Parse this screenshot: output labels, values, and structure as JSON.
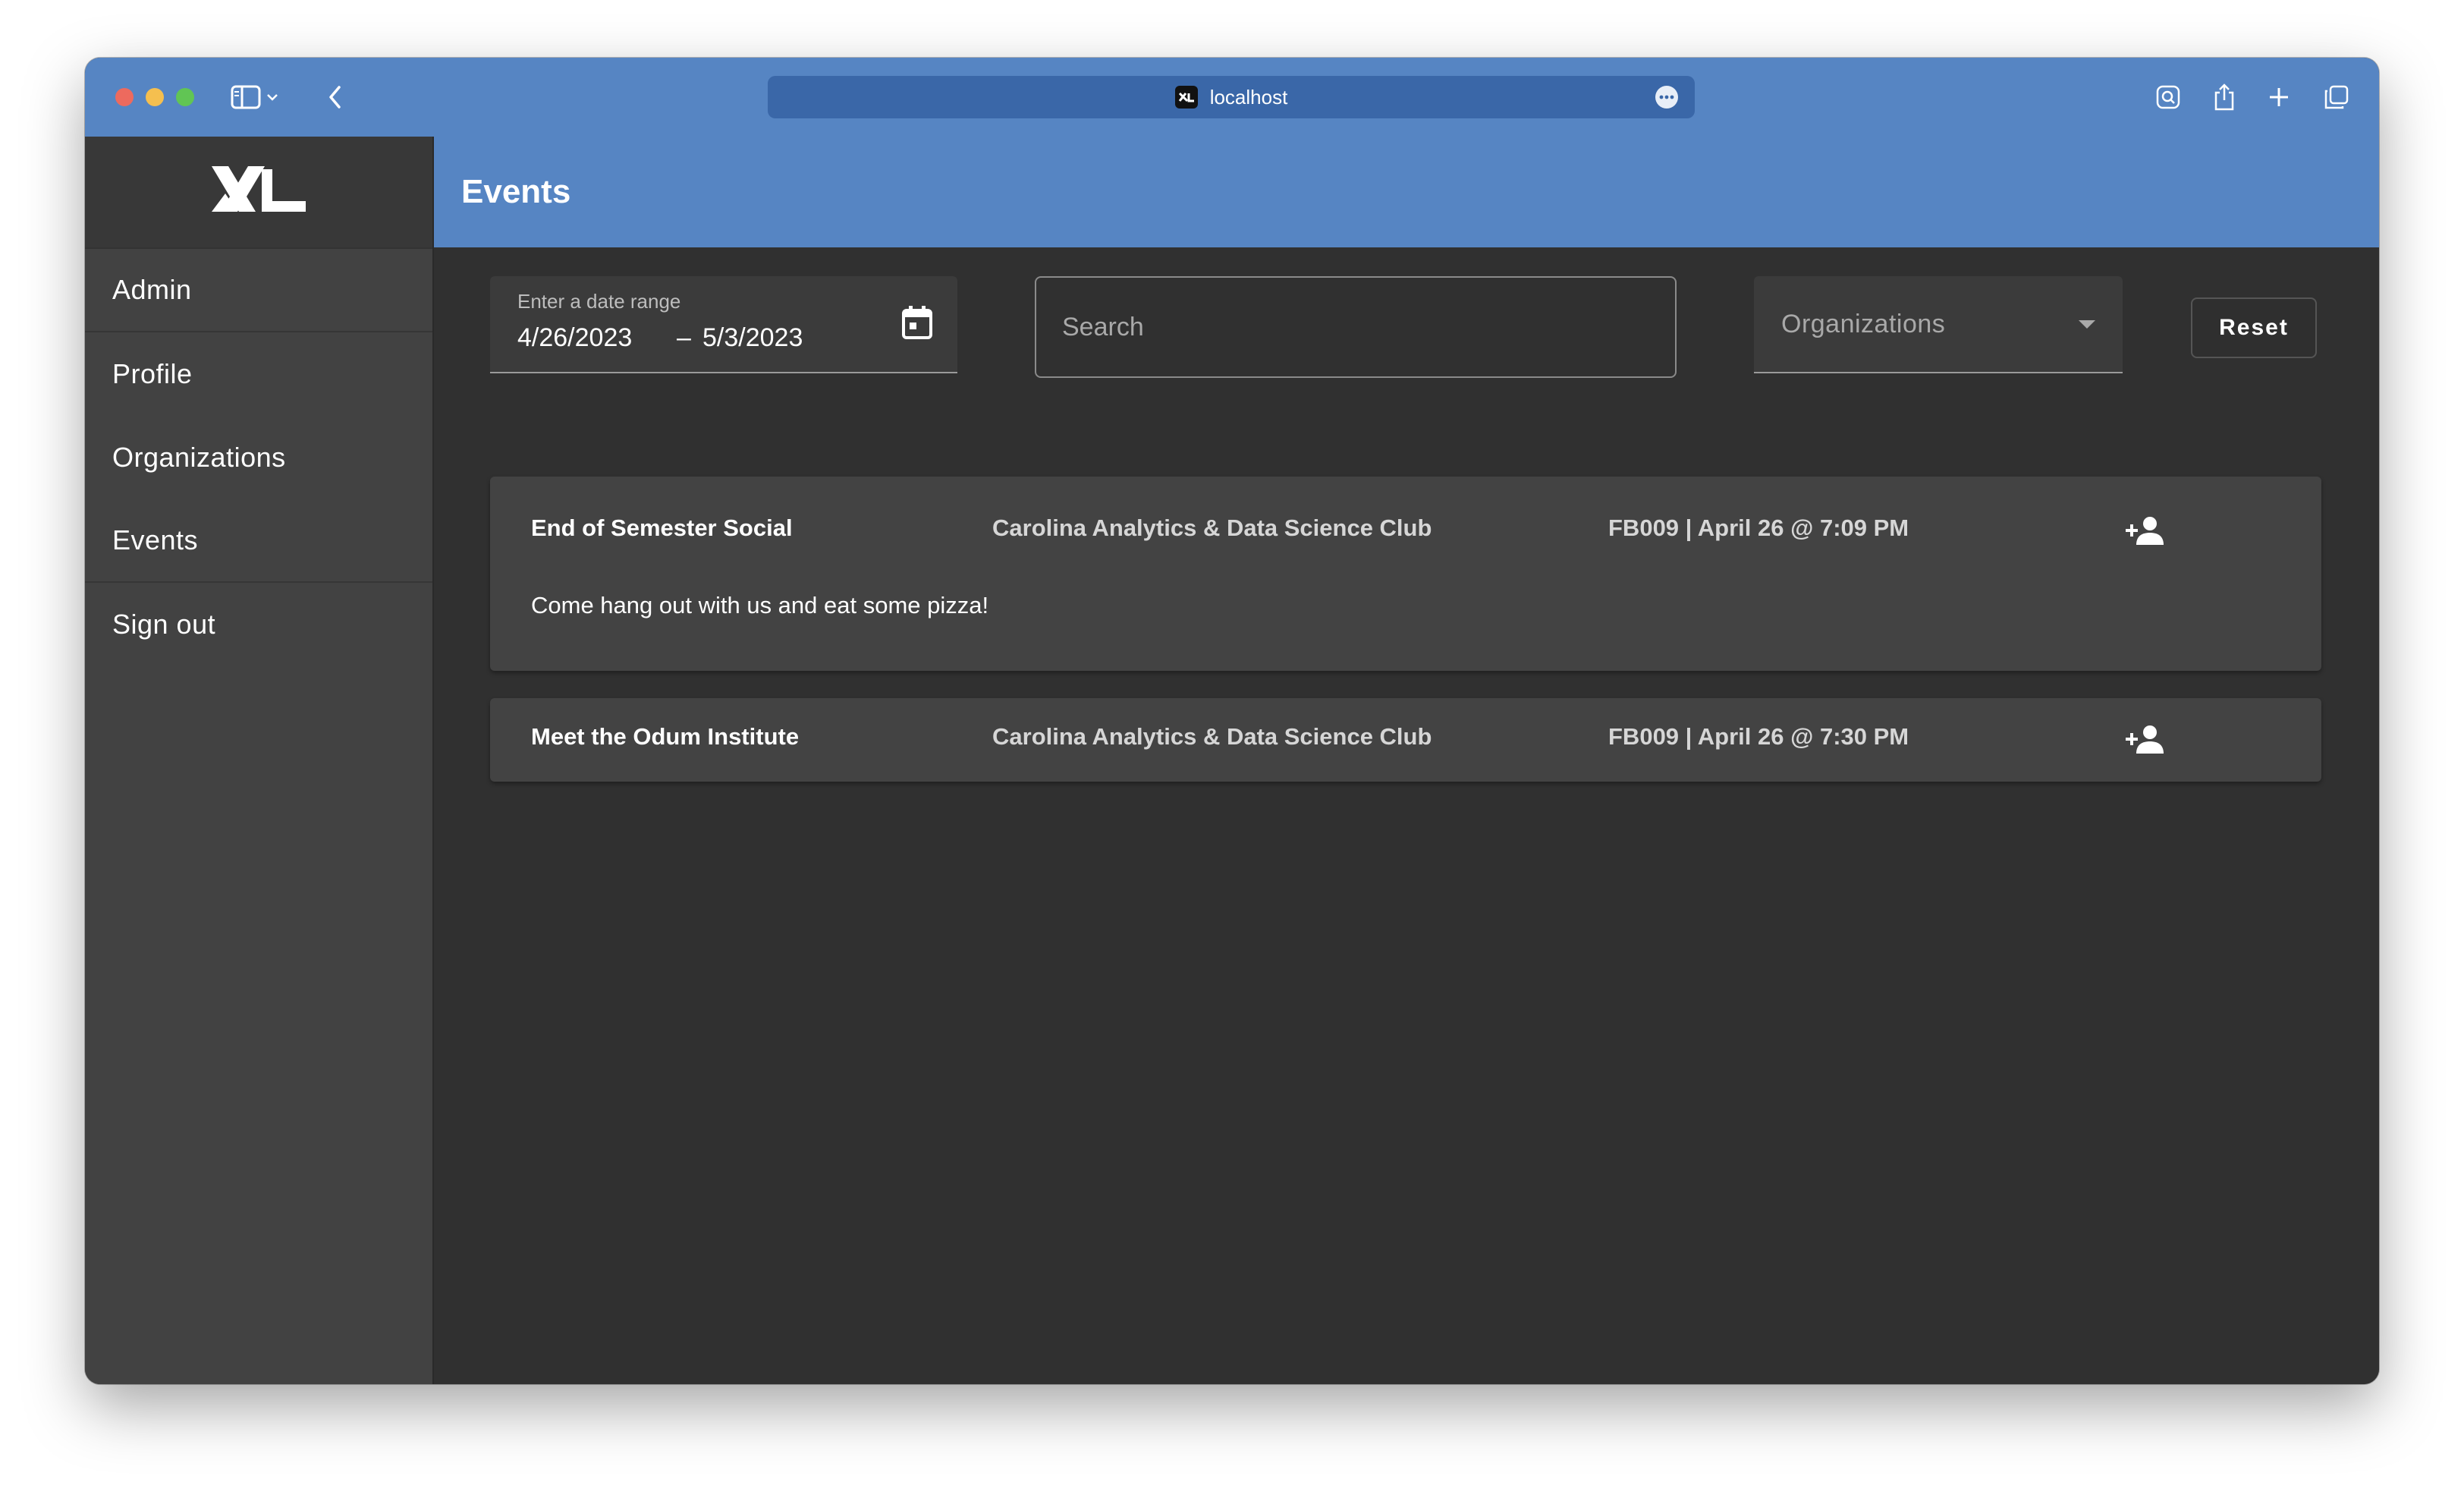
{
  "browser": {
    "address": "localhost",
    "favicon_text": "XL"
  },
  "sidebar": {
    "logo_text": "XL",
    "items": [
      {
        "label": "Admin"
      },
      {
        "label": "Profile"
      },
      {
        "label": "Organizations"
      },
      {
        "label": "Events"
      },
      {
        "label": "Sign out"
      }
    ]
  },
  "header": {
    "title": "Events"
  },
  "filters": {
    "date_range": {
      "label": "Enter a date range",
      "start": "4/26/2023",
      "separator": "–",
      "end": "5/3/2023"
    },
    "search": {
      "placeholder": "Search",
      "value": ""
    },
    "organizations": {
      "label": "Organizations"
    },
    "reset_label": "Reset"
  },
  "events": [
    {
      "title": "End of Semester Social",
      "organization": "Carolina Analytics & Data Science Club",
      "when": "FB009 | April 26 @ 7:09 PM",
      "description": "Come hang out with us and eat some pizza!"
    },
    {
      "title": "Meet the Odum Institute",
      "organization": "Carolina Analytics & Data Science Club",
      "when": "FB009 | April 26 @ 7:30 PM"
    }
  ],
  "colors": {
    "accent": "#5685c3",
    "sidebar": "#424242",
    "content": "#303030",
    "card": "#434343"
  }
}
